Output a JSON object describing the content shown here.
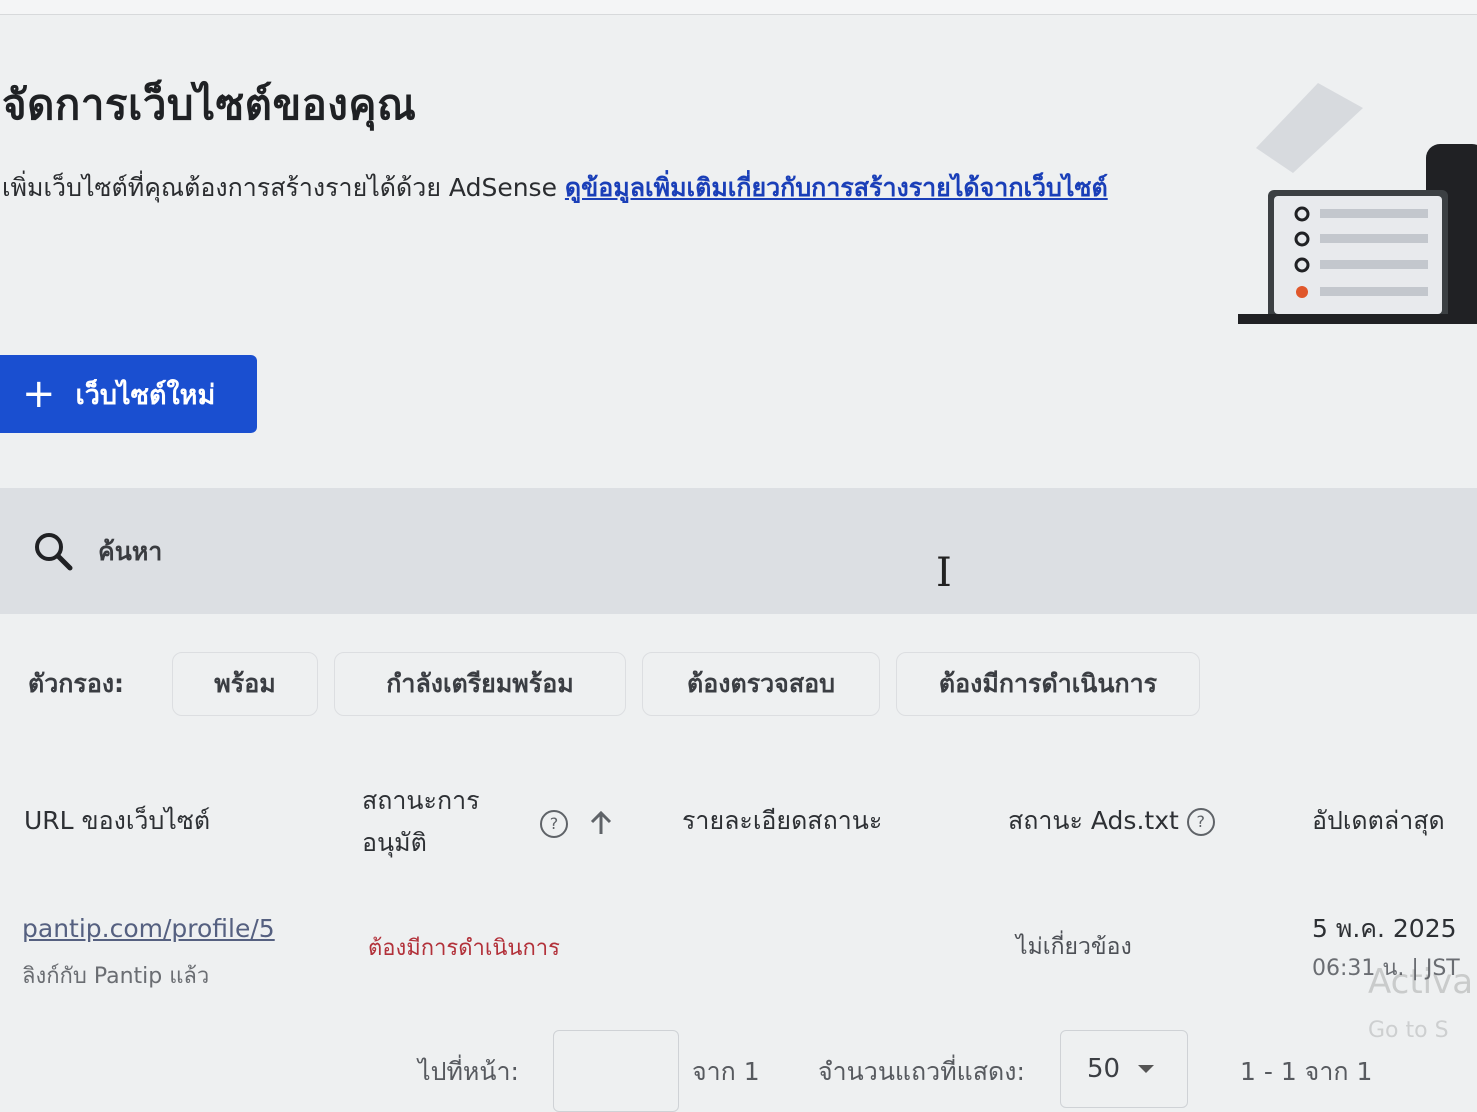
{
  "header": {
    "title": "จัดการเว็บไซต์ของคุณ",
    "description": "เพิ่มเว็บไซต์ที่คุณต้องการสร้างรายได้ด้วย AdSense",
    "learn_more_link": "ดูข้อมูลเพิ่มเติมเกี่ยวกับการสร้างรายได้จากเว็บไซต์"
  },
  "toolbar": {
    "new_site_label": "เว็บไซต์ใหม่"
  },
  "search": {
    "placeholder": "ค้นหา"
  },
  "filters": {
    "label": "ตัวกรอง:",
    "chips": [
      "พร้อม",
      "กำลังเตรียมพร้อม",
      "ต้องตรวจสอบ",
      "ต้องมีการดำเนินการ"
    ]
  },
  "table": {
    "columns": {
      "url": "URL ของเว็บไซต์",
      "approval_line1": "สถานะการ",
      "approval_line2": "อนุมัติ",
      "details": "รายละเอียดสถานะ",
      "ads_txt": "สถานะ Ads.txt",
      "updated": "อัปเดตล่าสุด"
    },
    "rows": [
      {
        "url": "pantip.com/profile/5",
        "url_sub": "ลิงก์กับ Pantip แล้ว",
        "approval": "ต้องมีการดำเนินการ",
        "details": "",
        "ads_txt": "ไม่เกี่ยวข้อง",
        "updated_date": "5 พ.ค. 2025",
        "updated_time": "06:31 น. | JST"
      }
    ]
  },
  "pagination": {
    "goto_label": "ไปที่หน้า:",
    "page_value": "",
    "of_pages": "จาก 1",
    "rows_label": "จำนวนแถวที่แสดง:",
    "rows_value": "50",
    "range": "1 - 1 จาก 1"
  },
  "overlay": {
    "activate_line1": "Activa",
    "activate_line2": "Go to S"
  },
  "colors": {
    "primary": "#1a4fd0",
    "link": "#1a3fb8",
    "status_red": "#b2313a",
    "search_bg": "#dcdfe3"
  }
}
